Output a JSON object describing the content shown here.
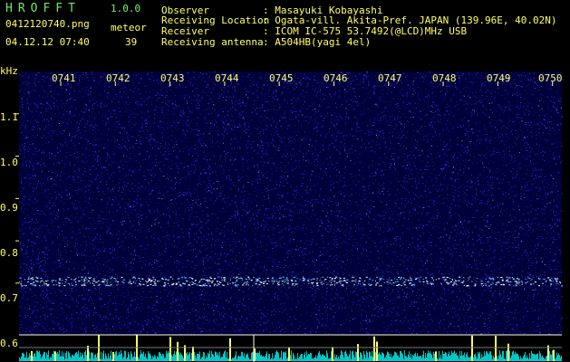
{
  "app": {
    "name": "HROFFT",
    "version": "1.0.0"
  },
  "file": {
    "name": "0412120740.png",
    "datetime": "04.12.12 07:40"
  },
  "meteor": {
    "label": "meteor",
    "count": "39"
  },
  "info": [
    {
      "key": "Observer",
      "value": ": Masayuki Kobayashi"
    },
    {
      "key": "Receiving Location",
      "value": ": Ogata-vill. Akita-Pref. JAPAN (139.96E, 40.02N)"
    },
    {
      "key": "Receiver",
      "value": ": ICOM IC-575 53.7492(@LCD)MHz USB"
    },
    {
      "key": "Receiving antenna",
      "value": ": A504HB(yagi 4el)"
    }
  ],
  "chart_data": {
    "type": "heatmap",
    "ylabel": "kHz",
    "x_ticks": [
      "0741",
      "0742",
      "0743",
      "0744",
      "0745",
      "0746",
      "0747",
      "0748",
      "0749",
      "0750"
    ],
    "y_ticks": [
      "1.1",
      "1.0",
      "0.9",
      "0.8",
      "0.7",
      "0.6"
    ],
    "ylim": [
      0.58,
      1.2
    ],
    "colors": {
      "background": "#00003a",
      "noise": "#3a3aff",
      "signal": "#4fe0ff",
      "histogram": "#00c8c8",
      "peak": "#ffff66"
    }
  }
}
